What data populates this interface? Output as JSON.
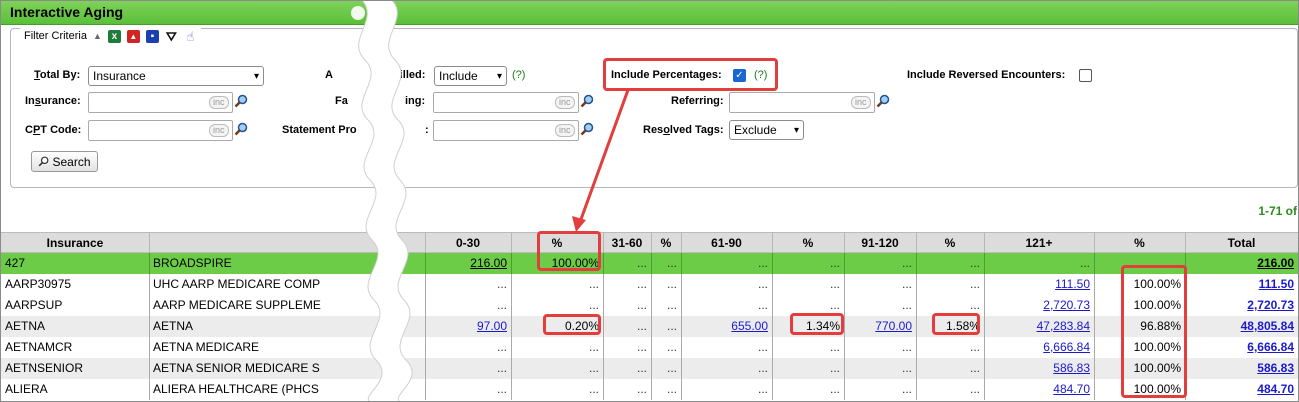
{
  "window": {
    "title": "Interactive Aging"
  },
  "filter": {
    "legend": "Filter Criteria",
    "total_by": {
      "label_pre": "",
      "label_u": "T",
      "label_post": "otal By:",
      "value": "Insurance"
    },
    "insurance": {
      "label_pre": "In",
      "label_u": "s",
      "label_post": "urance:"
    },
    "cpt": {
      "label_pre": "C",
      "label_u": "P",
      "label_post": "T Code:"
    },
    "a_billed": {
      "label_left": "A",
      "label_right": "billed:",
      "value": "Include",
      "help": "(?)"
    },
    "fa_ing": {
      "label_left": "Fa",
      "label_right": "ing:"
    },
    "statement": {
      "label_pre": "Statement Pro",
      "label_right": ":",
      "u_index": "m"
    },
    "include_percentages": {
      "label": "Include Percentages:",
      "checked": true,
      "help": "(?)"
    },
    "referring": {
      "label": "Referring:"
    },
    "resolved_tags": {
      "label_pre": "Res",
      "label_u": "o",
      "label_post": "lved Tags:",
      "value": "Exclude"
    },
    "include_reversed": {
      "label": "Include Reversed Encounters:",
      "checked": false
    },
    "inc_tag": "inc",
    "search_label": "Search"
  },
  "paging": "1-71 of",
  "grid": {
    "headers": [
      "Insurance",
      "",
      "0-30",
      "%",
      "31-60",
      "%",
      "61-90",
      "%",
      "91-120",
      "%",
      "121+",
      "%",
      "Total"
    ],
    "rows": [
      {
        "code": "427",
        "name": "BROADSPIRE",
        "c030": "216.00",
        "p030": "100.00%",
        "c3160": "...",
        "p3160": "...",
        "c6190": "...",
        "p6190": "...",
        "c91120": "...",
        "p91120": "...",
        "c121": "...",
        "p121": "...",
        "total": "216.00",
        "hi": true
      },
      {
        "code": "AARP30975",
        "name": "UHC AARP MEDICARE COMP",
        "c030": "...",
        "p030": "...",
        "c3160": "...",
        "p3160": "...",
        "c6190": "...",
        "p6190": "...",
        "c91120": "...",
        "p91120": "...",
        "c121": "111.50",
        "p121": "100.00%",
        "total": "111.50"
      },
      {
        "code": "AARPSUP",
        "name": "AARP MEDICARE SUPPLEME",
        "c030": "...",
        "p030": "...",
        "c3160": "...",
        "p3160": "...",
        "c6190": "...",
        "p6190": "...",
        "c91120": "...",
        "p91120": "...",
        "c121": "2,720.73",
        "p121": "100.00%",
        "total": "2,720.73"
      },
      {
        "code": "AETNA",
        "name": "AETNA",
        "c030": "97.00",
        "p030": "0.20%",
        "c3160": "...",
        "p3160": "...",
        "c6190": "655.00",
        "p6190": "1.34%",
        "c91120": "770.00",
        "p91120": "1.58%",
        "c121": "47,283.84",
        "p121": "96.88%",
        "total": "48,805.84"
      },
      {
        "code": "AETNAMCR",
        "name": "AETNA MEDICARE",
        "c030": "...",
        "p030": "...",
        "c3160": "...",
        "p3160": "...",
        "c6190": "...",
        "p6190": "...",
        "c91120": "...",
        "p91120": "...",
        "c121": "6,666.84",
        "p121": "100.00%",
        "total": "6,666.84"
      },
      {
        "code": "AETNSENIOR",
        "name": "AETNA SENIOR MEDICARE S",
        "c030": "...",
        "p030": "...",
        "c3160": "...",
        "p3160": "...",
        "c6190": "...",
        "p6190": "...",
        "c91120": "...",
        "p91120": "...",
        "c121": "586.83",
        "p121": "100.00%",
        "total": "586.83"
      },
      {
        "code": "ALIERA",
        "name": "ALIERA HEALTHCARE (PHCS",
        "c030": "...",
        "p030": "...",
        "c3160": "...",
        "p3160": "...",
        "c6190": "...",
        "p6190": "...",
        "c91120": "...",
        "p91120": "...",
        "c121": "484.70",
        "p121": "100.00%",
        "total": "484.70"
      }
    ]
  },
  "colors": {
    "title_green": "#5bbf39",
    "row_highlight": "#6ccc47",
    "callout_red": "#e23e3e",
    "link_blue": "#1a1acc"
  }
}
